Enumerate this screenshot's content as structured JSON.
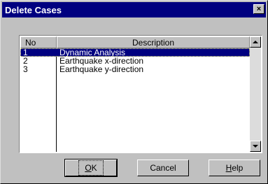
{
  "window": {
    "title": "Delete Cases",
    "close_glyph": "×"
  },
  "list": {
    "columns": [
      "No",
      "Description"
    ],
    "rows": [
      {
        "no": "1",
        "description": "Dynamic Analysis",
        "selected": true
      },
      {
        "no": "2",
        "description": "Earthquake x-direction",
        "selected": false
      },
      {
        "no": "3",
        "description": "Earthquake y-direction",
        "selected": false
      }
    ]
  },
  "buttons": {
    "ok": {
      "mnemonic": "O",
      "rest": "K"
    },
    "cancel": {
      "label": "Cancel"
    },
    "help": {
      "mnemonic": "H",
      "rest": "elp"
    }
  },
  "colors": {
    "titlebar": "#000080",
    "selection": "#000080",
    "face": "#c0c0c0"
  }
}
